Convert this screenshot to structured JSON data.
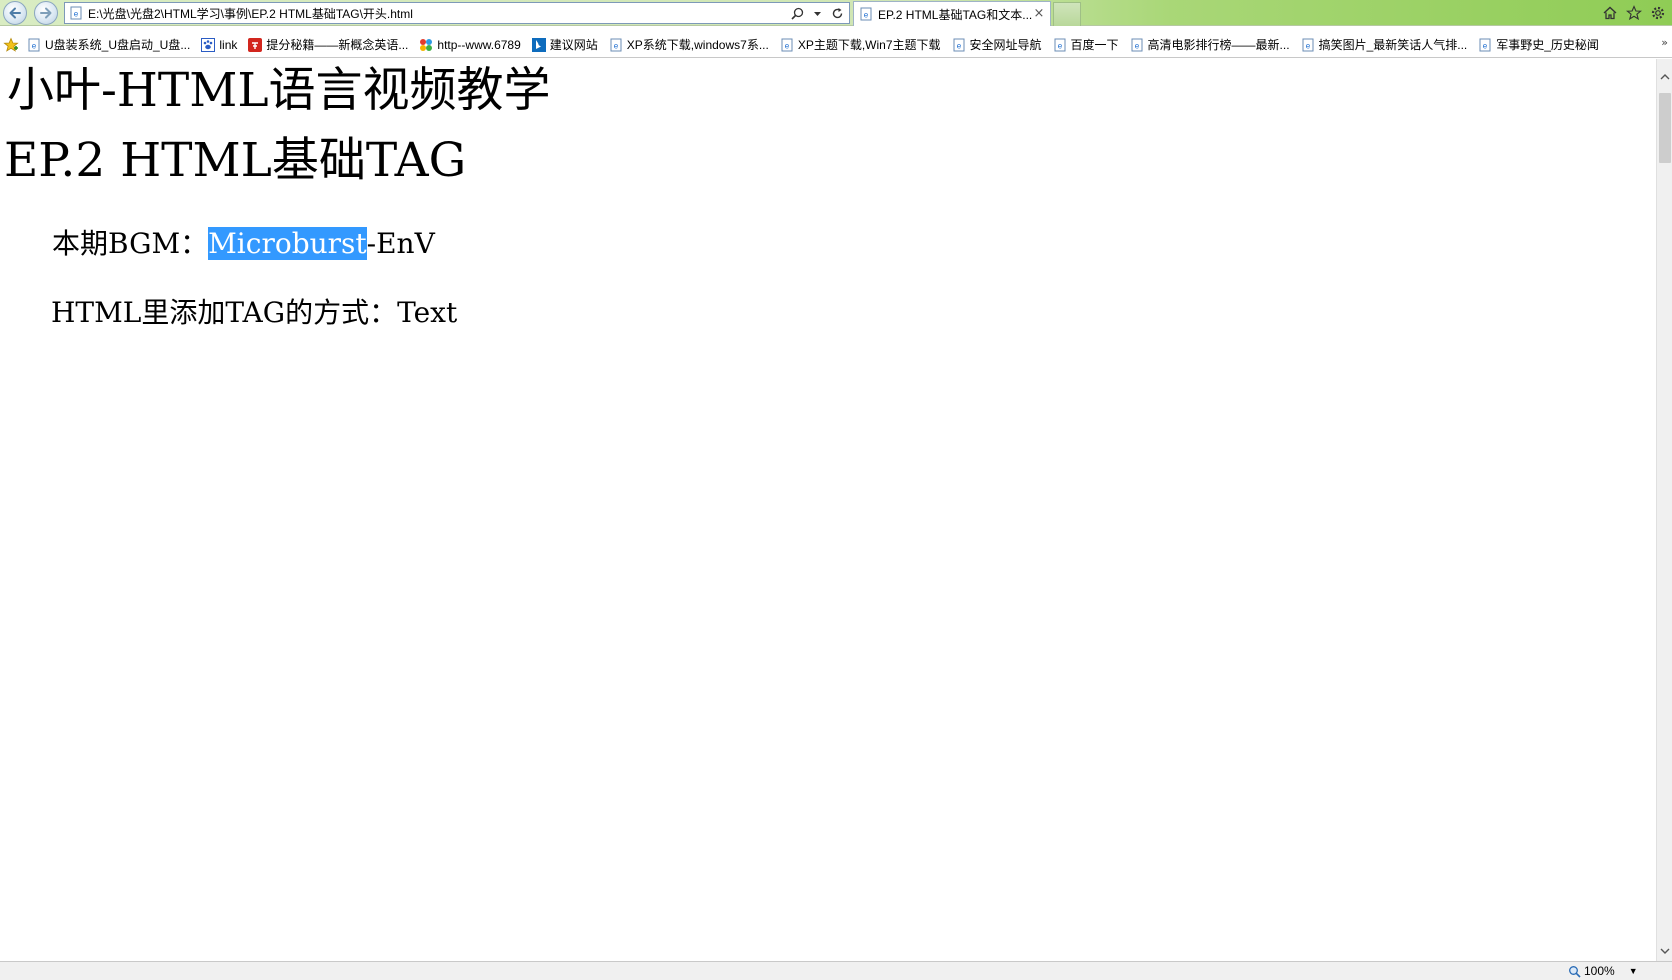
{
  "browser": {
    "address": "E:\\光盘\\光盘2\\HTML学习\\事例\\EP.2 HTML基础TAG\\开头.html",
    "tab_title": "EP.2 HTML基础TAG和文本...",
    "tab_close": "×",
    "zoom": "100%",
    "zoom_caret": "▼",
    "fav_more": "»"
  },
  "favorites": [
    {
      "label": "U盘装系统_U盘启动_U盘...",
      "icon": "ie-page-icon"
    },
    {
      "label": "link",
      "icon": "baidu-paw-icon"
    },
    {
      "label": "提分秘籍——新概念英语...",
      "icon": "red-xue-icon"
    },
    {
      "label": "http--www.6789",
      "icon": "colorful-icon"
    },
    {
      "label": "建议网站",
      "icon": "bing-icon"
    },
    {
      "label": "XP系统下载,windows7系...",
      "icon": "ie-page-icon"
    },
    {
      "label": "XP主题下载,Win7主题下载",
      "icon": "ie-page-icon"
    },
    {
      "label": "安全网址导航",
      "icon": "ie-page-icon"
    },
    {
      "label": "百度一下",
      "icon": "ie-page-icon"
    },
    {
      "label": "高清电影排行榜——最新...",
      "icon": "ie-page-icon"
    },
    {
      "label": "搞笑图片_最新笑话人气排...",
      "icon": "ie-page-icon"
    },
    {
      "label": "军事野史_历史秘闻",
      "icon": "ie-page-icon"
    }
  ],
  "page": {
    "site_title": "小叶-HTML语言视频教学",
    "episode_title": "EP.2 HTML基础TAG",
    "bgm_prefix": "本期BGM：",
    "bgm_selected": "Microburst",
    "bgm_suffix": "-EnV",
    "tag_line": "HTML里添加TAG的方式：Text"
  },
  "colors": {
    "selection": "#3399ff",
    "toolbar_green": "#8fcc55"
  }
}
